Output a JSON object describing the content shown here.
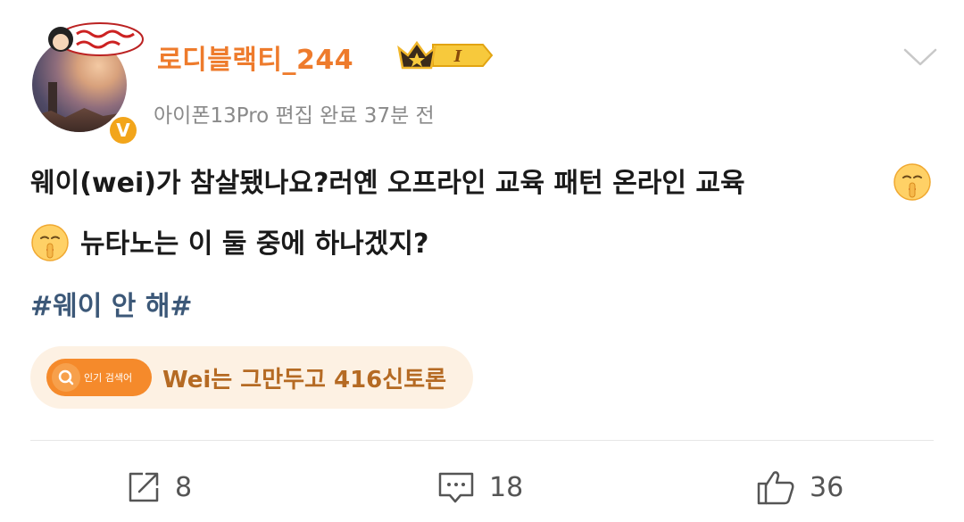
{
  "user": {
    "name": "로디블랙티_244",
    "meta": "아이폰13Pro 편집 완료 37분 전",
    "avatar_icon": "avatar-photo",
    "verified_badge": "V",
    "level_badge": "I"
  },
  "post": {
    "line1": "웨이(wei)가 참살됐나요?러옌 오프라인 교육 패턴 온라인 교육",
    "line2": "뉴타노는 이 둘 중에 하나겠지?",
    "hashtag": "#웨이 안 해#",
    "emoji_icon": "shush-emoji"
  },
  "hot_search": {
    "tag": "인기 검색어",
    "text": "Wei는 그만두고 416신토론"
  },
  "actions": {
    "share_count": "8",
    "comment_count": "18",
    "like_count": "36"
  },
  "colors": {
    "username": "#ee7b2c",
    "hashtag": "#3c5878",
    "hot_bg": "#fdf1e3",
    "hot_accent": "#f58a2b",
    "hot_text": "#b56a23"
  }
}
